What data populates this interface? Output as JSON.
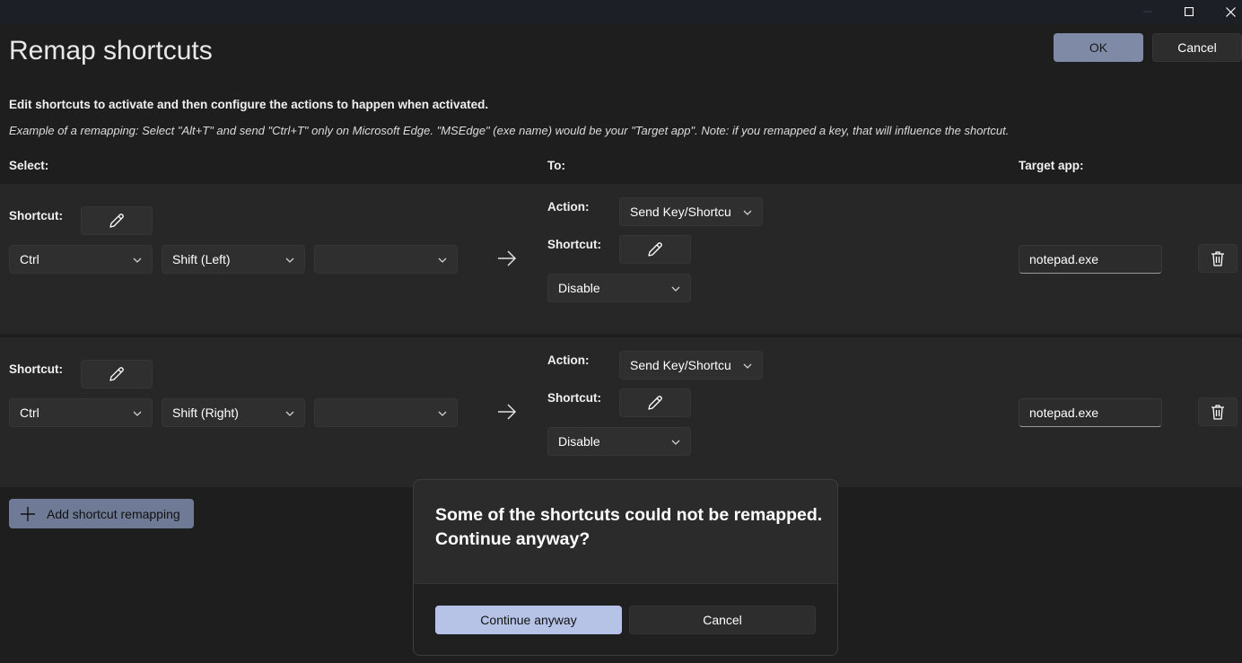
{
  "window": {
    "minimize_icon": "minimize-icon",
    "maximize_icon": "maximize-icon",
    "close_icon": "close-icon"
  },
  "header": {
    "title": "Remap shortcuts",
    "ok_label": "OK",
    "cancel_label": "Cancel"
  },
  "description": "Edit shortcuts to activate and then configure the actions to happen when activated.",
  "example": "Example of a remapping: Select \"Alt+T\" and send \"Ctrl+T\" only on Microsoft Edge. \"MSEdge\" (exe name) would be your \"Target app\". Note: if you remapped a key, that will influence the shortcut.",
  "columns": {
    "select": "Select:",
    "to": "To:",
    "target_app": "Target app:"
  },
  "rows": [
    {
      "shortcut_label": "Shortcut:",
      "keys": [
        "Ctrl",
        "Shift (Left)",
        ""
      ],
      "action_label": "Action:",
      "action_value": "Send Key/Shortcu",
      "to_shortcut_label": "Shortcut:",
      "to_key": "Disable",
      "target_app": "notepad.exe"
    },
    {
      "shortcut_label": "Shortcut:",
      "keys": [
        "Ctrl",
        "Shift (Right)",
        ""
      ],
      "action_label": "Action:",
      "action_value": "Send Key/Shortcu",
      "to_shortcut_label": "Shortcut:",
      "to_key": "Disable",
      "target_app": "notepad.exe"
    }
  ],
  "add_button_label": "Add shortcut remapping",
  "dialog": {
    "message": "Some of the shortcuts could not be remapped. Continue anyway?",
    "continue_label": "Continue anyway",
    "cancel_label": "Cancel"
  },
  "colors": {
    "accent": "#7f8aa6",
    "dialog_primary": "#b6c3e6",
    "background": "#202020"
  }
}
